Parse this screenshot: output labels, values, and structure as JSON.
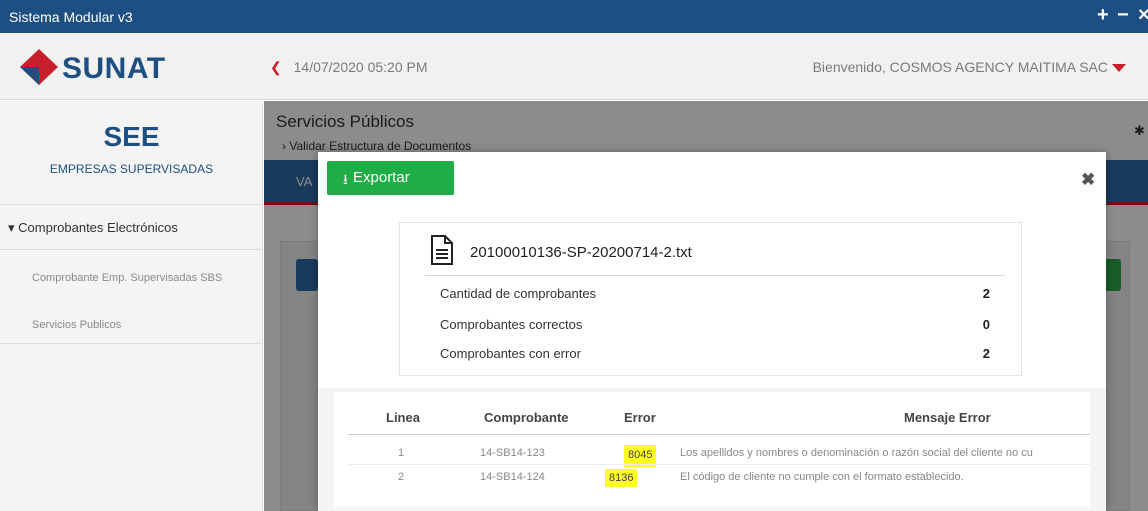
{
  "window": {
    "title": "Sistema Modular v3",
    "buttons": [
      "+",
      "−",
      "×"
    ]
  },
  "header": {
    "logo_text": "SUNAT",
    "datetime": "14/07/2020 05:20 PM",
    "welcome": "Bienvenido, COSMOS AGENCY MAITIMA SAC",
    "accent_color": "#c8202a"
  },
  "sidebar": {
    "title": "SEE",
    "subtitle": "EMPRESAS SUPERVISADAS",
    "section": "▾ Comprobantes Electrónicos",
    "items": [
      {
        "label": "Comprobante Emp. Supervisadas SBS"
      },
      {
        "label": "Servicios Publicos"
      }
    ]
  },
  "main": {
    "page_title": "Servicios Públicos",
    "breadcrumb": "› Validar Estructura de Documentos",
    "tab_label": "VA"
  },
  "modal": {
    "export_label": "Exportar",
    "file_name": "20100010136-SP-20200714-2.txt",
    "summary": [
      {
        "label": "Cantidad de comprobantes",
        "value": "2"
      },
      {
        "label": "Comprobantes correctos",
        "value": "0"
      },
      {
        "label": "Comprobantes con error",
        "value": "2"
      }
    ],
    "table": {
      "headers": {
        "linea": "Linea",
        "comprobante": "Comprobante",
        "error": "Error",
        "mensaje": "Mensaje Error"
      },
      "rows": [
        {
          "linea": "1",
          "comprobante": "14-SB14-123",
          "error": "8045",
          "mensaje": "Los apellidos y nombres o denominación o razón social del cliente no cu"
        },
        {
          "linea": "2",
          "comprobante": "14-SB14-124",
          "error": "8136",
          "mensaje": "El código de cliente no cumple con el formato establecido."
        }
      ]
    }
  }
}
